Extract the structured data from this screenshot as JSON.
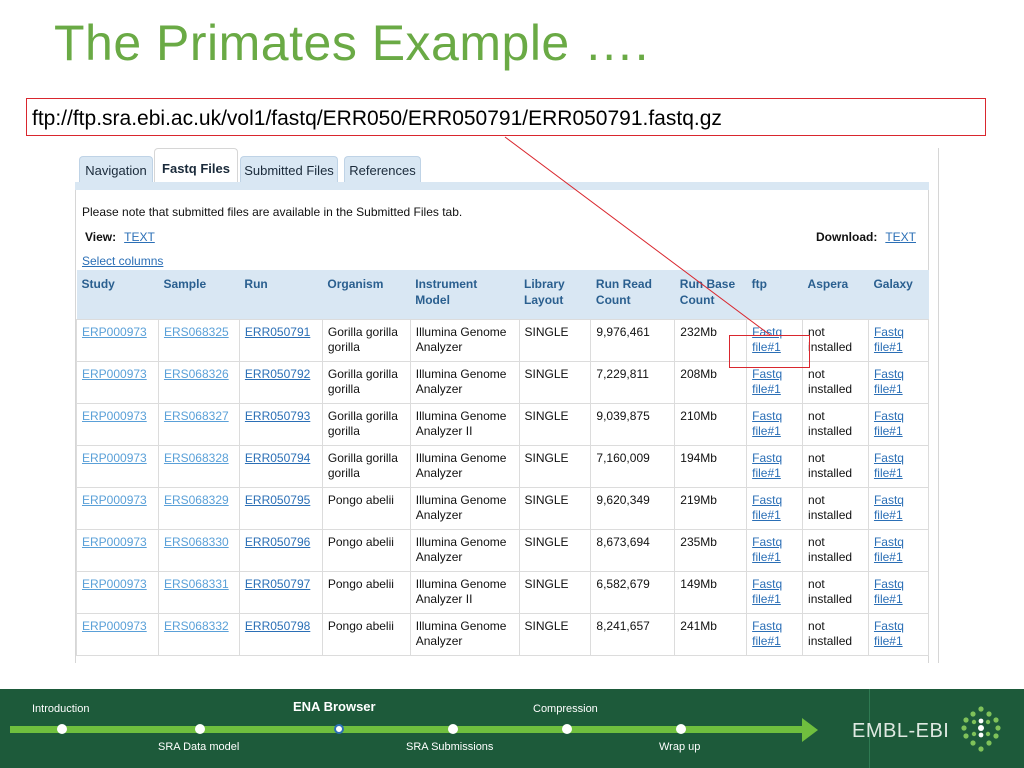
{
  "slide": {
    "title": "The Primates Example ….",
    "url": "ftp://ftp.sra.ebi.ac.uk/vol1/fastq/ERR050/ERR050791/ERR050791.fastq.gz"
  },
  "browser": {
    "tabs": [
      {
        "label": "Navigation",
        "active": false
      },
      {
        "label": "Fastq Files",
        "active": true
      },
      {
        "label": "Submitted Files",
        "active": false
      },
      {
        "label": "References",
        "active": false
      }
    ],
    "note": "Please note that submitted files are available in the Submitted Files tab.",
    "view_label": "View:",
    "view_link": "TEXT",
    "download_label": "Download:",
    "download_link": "TEXT",
    "select_columns": "Select columns",
    "columns": [
      "Study",
      "Sample",
      "Run",
      "Organism",
      "Instrument Model",
      "Library Layout",
      "Run Read Count",
      "Run Base Count",
      "ftp",
      "Aspera",
      "Galaxy"
    ],
    "rows": [
      {
        "study": "ERP000973",
        "sample": "ERS068325",
        "run": "ERR050791",
        "organism": "Gorilla gorilla gorilla",
        "instrument": "Illumina Genome Analyzer",
        "layout": "SINGLE",
        "read_count": "9,976,461",
        "base_count": "232Mb",
        "ftp": "Fastq file#1",
        "aspera": "not installed",
        "galaxy": "Fastq file#1"
      },
      {
        "study": "ERP000973",
        "sample": "ERS068326",
        "run": "ERR050792",
        "organism": "Gorilla gorilla gorilla",
        "instrument": "Illumina Genome Analyzer",
        "layout": "SINGLE",
        "read_count": "7,229,811",
        "base_count": "208Mb",
        "ftp": "Fastq file#1",
        "aspera": "not installed",
        "galaxy": "Fastq file#1"
      },
      {
        "study": "ERP000973",
        "sample": "ERS068327",
        "run": "ERR050793",
        "organism": "Gorilla gorilla gorilla",
        "instrument": "Illumina Genome Analyzer II",
        "layout": "SINGLE",
        "read_count": "9,039,875",
        "base_count": "210Mb",
        "ftp": "Fastq file#1",
        "aspera": "not installed",
        "galaxy": "Fastq file#1"
      },
      {
        "study": "ERP000973",
        "sample": "ERS068328",
        "run": "ERR050794",
        "organism": "Gorilla gorilla gorilla",
        "instrument": "Illumina Genome Analyzer",
        "layout": "SINGLE",
        "read_count": "7,160,009",
        "base_count": "194Mb",
        "ftp": "Fastq file#1",
        "aspera": "not installed",
        "galaxy": "Fastq file#1"
      },
      {
        "study": "ERP000973",
        "sample": "ERS068329",
        "run": "ERR050795",
        "organism": "Pongo abelii",
        "instrument": "Illumina Genome Analyzer",
        "layout": "SINGLE",
        "read_count": "9,620,349",
        "base_count": "219Mb",
        "ftp": "Fastq file#1",
        "aspera": "not installed",
        "galaxy": "Fastq file#1"
      },
      {
        "study": "ERP000973",
        "sample": "ERS068330",
        "run": "ERR050796",
        "organism": "Pongo abelii",
        "instrument": "Illumina Genome Analyzer",
        "layout": "SINGLE",
        "read_count": "8,673,694",
        "base_count": "235Mb",
        "ftp": "Fastq file#1",
        "aspera": "not installed",
        "galaxy": "Fastq file#1"
      },
      {
        "study": "ERP000973",
        "sample": "ERS068331",
        "run": "ERR050797",
        "organism": "Pongo abelii",
        "instrument": "Illumina Genome Analyzer II",
        "layout": "SINGLE",
        "read_count": "6,582,679",
        "base_count": "149Mb",
        "ftp": "Fastq file#1",
        "aspera": "not installed",
        "galaxy": "Fastq file#1"
      },
      {
        "study": "ERP000973",
        "sample": "ERS068332",
        "run": "ERR050798",
        "organism": "Pongo abelii",
        "instrument": "Illumina Genome Analyzer",
        "layout": "SINGLE",
        "read_count": "8,241,657",
        "base_count": "241Mb",
        "ftp": "Fastq file#1",
        "aspera": "not installed",
        "galaxy": "Fastq file#1"
      }
    ]
  },
  "footer": {
    "steps": [
      {
        "label": "Introduction",
        "current": false
      },
      {
        "label": "SRA Data model",
        "current": false
      },
      {
        "label": "ENA Browser",
        "current": true
      },
      {
        "label": "SRA Submissions",
        "current": false
      },
      {
        "label": "Compression",
        "current": false
      },
      {
        "label": "Wrap up",
        "current": false
      }
    ],
    "logo_text": "EMBL-EBI"
  },
  "colors": {
    "title_green": "#6aaa45",
    "highlight_red": "#d9272e",
    "link_blue": "#2b6fb6",
    "header_blue": "#d9e7f3",
    "footer_green": "#1d5a3a",
    "track_green": "#6fbf3e"
  },
  "icons": [
    "embl-ebi-logo-icon",
    "arrow-right-icon"
  ]
}
